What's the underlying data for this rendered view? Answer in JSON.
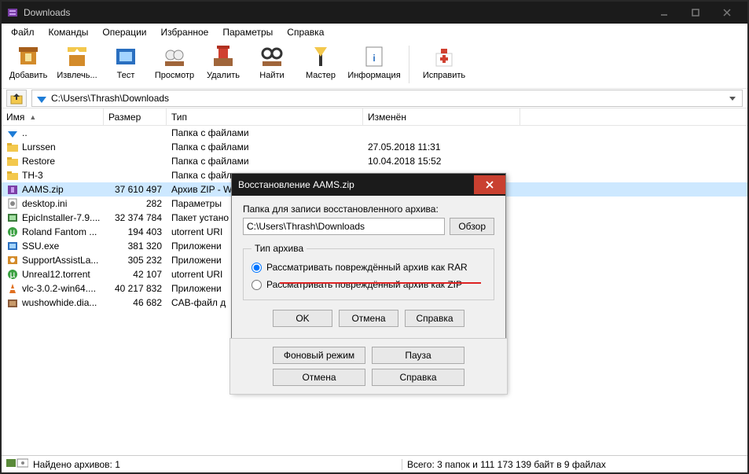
{
  "window": {
    "title": "Downloads"
  },
  "menu": [
    "Файл",
    "Команды",
    "Операции",
    "Избранное",
    "Параметры",
    "Справка"
  ],
  "toolbar": [
    {
      "label": "Добавить"
    },
    {
      "label": "Извлечь..."
    },
    {
      "label": "Тест"
    },
    {
      "label": "Просмотр"
    },
    {
      "label": "Удалить"
    },
    {
      "label": "Найти"
    },
    {
      "label": "Мастер"
    },
    {
      "label": "Информация"
    },
    {
      "label": "Исправить"
    }
  ],
  "path": "C:\\Users\\Thrash\\Downloads",
  "columns": {
    "name": "Имя",
    "size": "Размер",
    "type": "Тип",
    "modified": "Изменён"
  },
  "rows": [
    {
      "icon": "up",
      "name": "..",
      "size": "",
      "type": "Папка с файлами",
      "modified": ""
    },
    {
      "icon": "folder",
      "name": "Lurssen",
      "size": "",
      "type": "Папка с файлами",
      "modified": "27.05.2018 11:31"
    },
    {
      "icon": "folder",
      "name": "Restore",
      "size": "",
      "type": "Папка с файлами",
      "modified": "10.04.2018 15:52"
    },
    {
      "icon": "folder",
      "name": "TH-3",
      "size": "",
      "type": "Папка с файлами",
      "modified": ""
    },
    {
      "icon": "zip",
      "name": "AAMS.zip",
      "size": "37 610 497",
      "type": "Архив ZIP - W",
      "modified": "",
      "selected": true
    },
    {
      "icon": "ini",
      "name": "desktop.ini",
      "size": "282",
      "type": "Параметры",
      "modified": ""
    },
    {
      "icon": "exe",
      "name": "EpicInstaller-7.9....",
      "size": "32 374 784",
      "type": "Пакет устано",
      "modified": ""
    },
    {
      "icon": "torrent",
      "name": "Roland Fantom ...",
      "size": "194 403",
      "type": "utorrent URI",
      "modified": ""
    },
    {
      "icon": "exe2",
      "name": "SSU.exe",
      "size": "381 320",
      "type": "Приложени",
      "modified": ""
    },
    {
      "icon": "exe3",
      "name": "SupportAssistLa...",
      "size": "305 232",
      "type": "Приложени",
      "modified": ""
    },
    {
      "icon": "torrent",
      "name": "Unreal12.torrent",
      "size": "42 107",
      "type": "utorrent URI",
      "modified": ""
    },
    {
      "icon": "vlc",
      "name": "vlc-3.0.2-win64....",
      "size": "40 217 832",
      "type": "Приложени",
      "modified": ""
    },
    {
      "icon": "cab",
      "name": "wushowhide.dia...",
      "size": "46 682",
      "type": "CAB-файл д",
      "modified": ""
    }
  ],
  "status": {
    "left": "Найдено архивов: 1",
    "right": "Всего: 3 папок и 111 173 139 байт в 9 файлах"
  },
  "dialog": {
    "title": "Восстановление AAMS.zip",
    "path_label": "Папка для записи восстановленного архива:",
    "path_value": "C:\\Users\\Thrash\\Downloads",
    "browse": "Обзор",
    "group_label": "Тип архива",
    "radio_rar": "Рассматривать повреждённый архив как RAR",
    "radio_zip": "Рассматривать повреждённый архив как ZIP",
    "ok": "OK",
    "cancel": "Отмена",
    "help": "Справка",
    "bg_mode": "Фоновый режим",
    "pause": "Пауза",
    "cancel2": "Отмена",
    "help2": "Справка"
  }
}
